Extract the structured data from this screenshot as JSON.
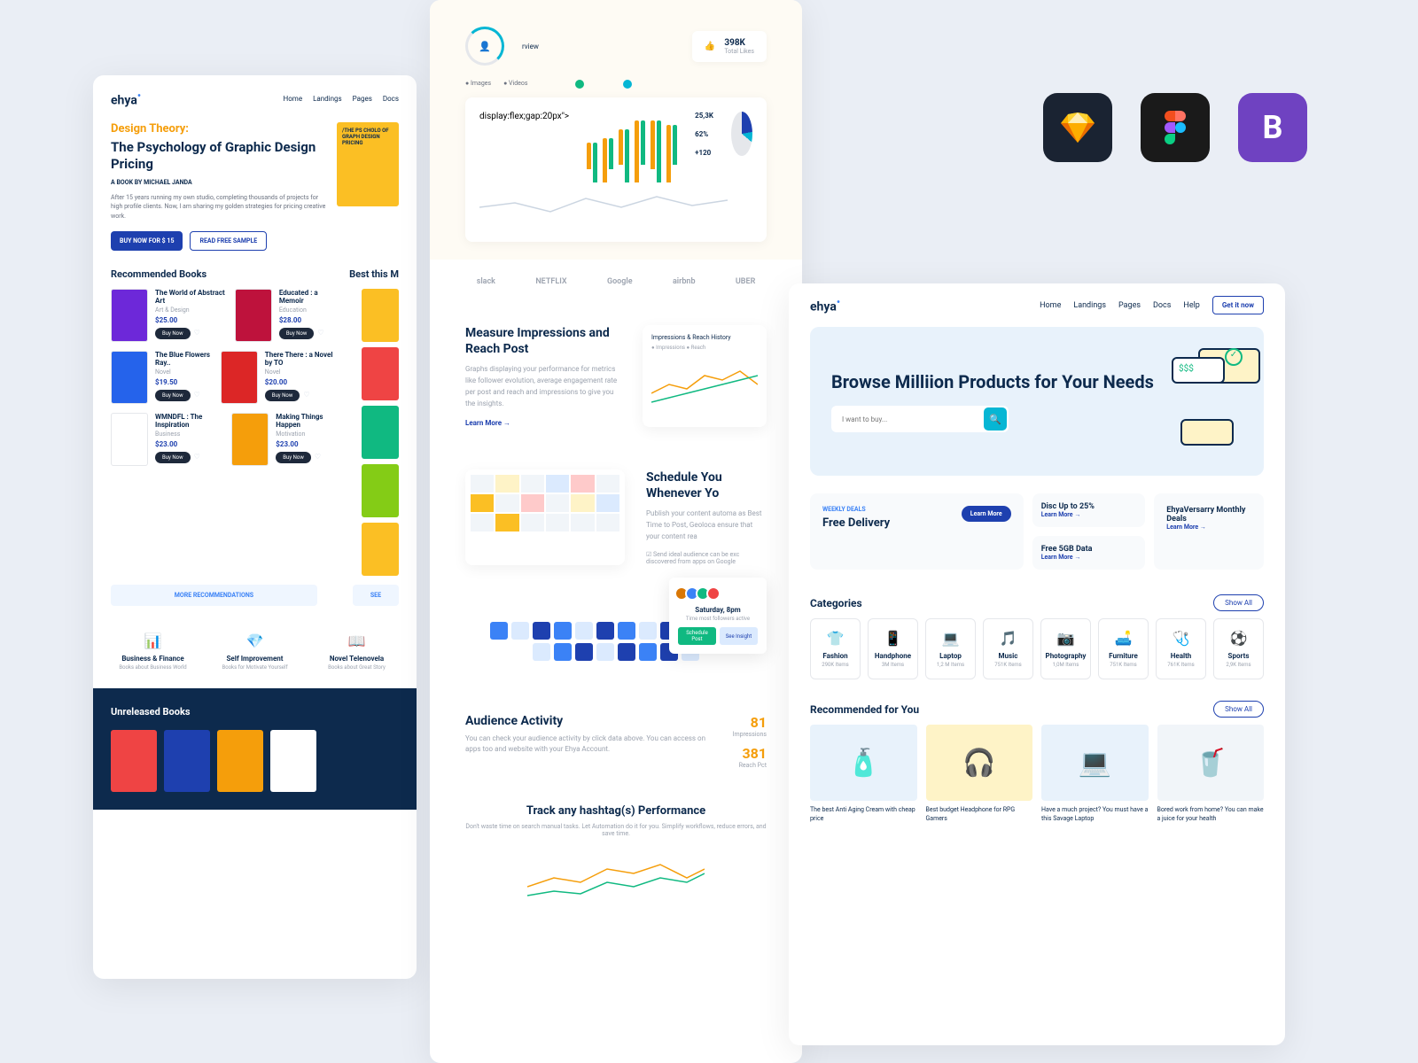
{
  "logo": "ehya",
  "nav": [
    "Home",
    "Landings",
    "Pages",
    "Docs"
  ],
  "bookstore": {
    "eyebrow": "Design Theory:",
    "title": "The Psychology of Graphic Design Pricing",
    "subtitle": "A BOOK BY MICHAEL JANDA",
    "desc": "After 15 years running my own studio, completing thousands of projects for high profile clients. Now, I am sharing my golden strategies for pricing creative work.",
    "buy": "BUY NOW FOR $ 15",
    "sample": "READ FREE SAMPLE",
    "mockup": "/THE PS CHOLO OF GRAPH DESIGN PRICING",
    "sec1": "Recommended Books",
    "sec2": "Best this M",
    "books": [
      {
        "title": "The World of Abstract Art",
        "cat": "Art & Design",
        "price": "$25.00"
      },
      {
        "title": "Educated : a Memoir",
        "cat": "Education",
        "price": "$28.00"
      },
      {
        "title": "The Blue Flowers Ray..",
        "cat": "Novel",
        "price": "$19.50"
      },
      {
        "title": "There There : a Novel by TO",
        "cat": "Novel",
        "price": "$20.00"
      },
      {
        "title": "WMNDFL : The Inspiration",
        "cat": "Business",
        "price": "$23.00"
      },
      {
        "title": "Making Things Happen",
        "cat": "Motivation",
        "price": "$23.00"
      }
    ],
    "buyNow": "Buy Now",
    "more": "MORE RECOMMENDATIONS",
    "see": "SEE",
    "cats": [
      {
        "name": "Business & Finance",
        "desc": "Books about Business World"
      },
      {
        "name": "Self Improvement",
        "desc": "Books for Motivate Yourself"
      },
      {
        "name": "Novel Telenovela",
        "desc": "Books about Great Story"
      }
    ],
    "unreleased": "Unreleased Books"
  },
  "analytics": {
    "overview": "rview",
    "tabs": [
      "Images",
      "Videos"
    ],
    "stat": {
      "num": "398K",
      "lbl": "Total Likes"
    },
    "sideStats": [
      "25,3K",
      "62%",
      "+120"
    ],
    "brands": [
      "slack",
      "NETFLIX",
      "Google",
      "airbnb",
      "UBER"
    ],
    "feature1": {
      "title": "Measure Impressions and Reach Post",
      "desc": "Graphs displaying your performance for metrics like follower evolution, average engagement rate per post and reach and impressions to give you the insights.",
      "chartTitle": "Impressions & Reach History",
      "legend": [
        "Impressions",
        "Reach"
      ]
    },
    "learn": "Learn More →",
    "feature2": {
      "title": "Schedule You Whenever Yo",
      "desc": "Publish your content automa as Best Time to Post, Geoloca ensure that your content rea"
    },
    "checkbox": "Send ideal audience can be exc discovered from apps on Google",
    "popup": {
      "day": "Saturday, 8pm",
      "sub": "Time most followers active",
      "btn1": "Schedule Post",
      "btn2": "See Insight"
    },
    "audience": {
      "title": "Audience Activity",
      "desc": "You can check your audience activity by click data above. You can access on apps too and website with your Ehya Account.",
      "n1": "81",
      "l1": "Impressions",
      "n2": "381",
      "l2": "Reach Pct"
    },
    "hashtag": {
      "title": "Track any hashtag(s) Performance",
      "desc": "Don't waste time on search manual tasks. Let Automation do it for you. Simplify workflows, reduce errors, and save time."
    }
  },
  "ecommerce": {
    "nav": [
      "Home",
      "Landings",
      "Pages",
      "Docs",
      "Help"
    ],
    "getBtn": "Get it now",
    "heroTitle": "Browse Milliion Products for Your Needs",
    "searchPlaceholder": "I want to buy...",
    "deal1": {
      "label": "WEEKLY DEALS",
      "title": "Free Delivery",
      "btn": "Learn More"
    },
    "deal2": {
      "title": "Disc Up to 25%",
      "link": "Learn More →"
    },
    "deal3": {
      "title": "Free 5GB Data",
      "link": "Learn More →"
    },
    "deal4": {
      "title": "EhyaVersarry Monthly Deals",
      "link": "Learn More →"
    },
    "catTitle": "Categories",
    "showAll": "Show All",
    "cats": [
      {
        "name": "Fashion",
        "count": "290K Items"
      },
      {
        "name": "Handphone",
        "count": "3M Items"
      },
      {
        "name": "Laptop",
        "count": "1,2 M Items"
      },
      {
        "name": "Music",
        "count": "751K Items"
      },
      {
        "name": "Photography",
        "count": "1,0M Items"
      },
      {
        "name": "Furniture",
        "count": "751K Items"
      },
      {
        "name": "Health",
        "count": "761K Items"
      },
      {
        "name": "Sports",
        "count": "2,9K Items"
      }
    ],
    "recTitle": "Recommended for You",
    "products": [
      "The best Anti Aging Cream with cheap price",
      "Best budget Headphone for RPG Gamers",
      "Have a much project? You must have a this Savage Laptop",
      "Bored work from home? You can make a juice for your health"
    ]
  }
}
